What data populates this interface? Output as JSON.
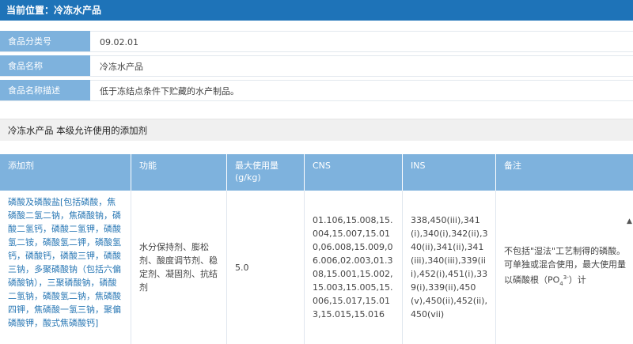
{
  "header": {
    "title": "当前位置：冷冻水产品"
  },
  "info": {
    "rows": [
      {
        "label": "食品分类号",
        "value": "09.02.01"
      },
      {
        "label": "食品名称",
        "value": "冷冻水产品"
      },
      {
        "label": "食品名称描述",
        "value": "低于冻结点条件下贮藏的水产制品。"
      }
    ]
  },
  "section": {
    "title": "冷冻水产品 本级允许使用的添加剂"
  },
  "table": {
    "headers": [
      "添加剂",
      "功能",
      "最大使用量(g/kg)",
      "CNS",
      "INS",
      "备注"
    ],
    "row": {
      "additive": "磷酸及磷酸盐[包括磷酸，焦磷酸二氢二钠，焦磷酸钠，磷酸二氢钙，磷酸二氢钾，磷酸氢二铵，磷酸氢二钾，磷酸氢钙，磷酸钙，磷酸三钾，磷酸三钠，多聚磷酸钠（包括六偏磷酸钠），三聚磷酸钠，磷酸二氢钠，磷酸氢二钠，焦磷酸四钾，焦磷酸一氢三钠，聚偏磷酸钾，酸式焦磷酸钙]",
      "function": "水分保持剂、膨松剂、酸度调节剂、稳定剂、凝固剂、抗结剂",
      "max_usage": "5.0",
      "cns": "01.106,15.008,15.004,15.007,15.010,06.008,15.009,06.006,02.003,01.308,15.001,15.002,15.003,15.005,15.006,15.017,15.013,15.015,15.016",
      "ins": "338,450(iii),341(i),340(i),342(ii),340(ii),341(ii),341(iii),340(iii),339(iii),452(i),451(i),339(i),339(ii),450(v),450(ii),452(ii),450(vii)",
      "remark_main": "不包括\"湿法\"工艺制得的磷酸。可单独或混合使用，最大使用量以磷酸根（PO",
      "remark_sub": "4",
      "remark_sup": "3-",
      "remark_end": "）计"
    }
  }
}
